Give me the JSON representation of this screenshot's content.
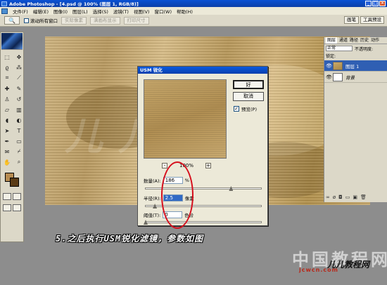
{
  "window": {
    "title": "Adobe Photoshop - [4.psd @ 100% (图层 1, RGB/8)]",
    "min_label": "_",
    "max_label": "□",
    "close_label": "×"
  },
  "menu": [
    "文件(F)",
    "编辑(E)",
    "图像(I)",
    "图层(L)",
    "选择(S)",
    "滤镜(T)",
    "视图(V)",
    "窗口(W)",
    "帮助(H)"
  ],
  "options_bar": {
    "checkbox_label": "滚动所有窗口",
    "buttons": [
      "实际像素",
      "满画布显示",
      "打印尺寸"
    ],
    "wells": [
      "画笔",
      "工具预设"
    ]
  },
  "dialog": {
    "title": "USM 锐化",
    "ok_label": "好",
    "cancel_label": "取消",
    "preview_label": "预览(P)",
    "preview_checked": "✓",
    "zoom_label": "100%",
    "zoom_out": "-",
    "zoom_in": "+",
    "amount": {
      "label": "数量(A):",
      "value": "186",
      "unit": "%"
    },
    "radius": {
      "label": "半径(R):",
      "value": "2.5",
      "unit": "像素"
    },
    "threshold": {
      "label": "阈值(T):",
      "value": "0",
      "unit": "色阶"
    },
    "amount_slider_pct": 74,
    "radius_slider_pct": 8,
    "threshold_slider_pct": 0
  },
  "layers_panel": {
    "tabs": [
      "图层",
      "通道",
      "路径",
      "历史",
      "动作"
    ],
    "blend_mode": "正常",
    "opacity_label": "不透明度:",
    "lock_label": "锁定:",
    "layers": [
      {
        "name": "图层 1",
        "eye": "👁",
        "active": true
      },
      {
        "name": "背景",
        "eye": "👁",
        "active": false
      }
    ]
  },
  "canvas_watermark": "儿儿教程",
  "caption": "5.之后执行USM锐化滤镜，参数如图",
  "branding": {
    "brand_text": "中国教程网",
    "site": "jcwcn.com",
    "logo_text": "儿儿教程网"
  },
  "colors": {
    "foreground": "#b78c52",
    "background": "#5a3b15",
    "annotation_circle": "#d60f1d",
    "title_bar": "#0a52d4"
  },
  "tools": [
    "marquee-icon",
    "move-icon",
    "lasso-icon",
    "magic-wand-icon",
    "crop-icon",
    "slice-icon",
    "healing-icon",
    "brush-icon",
    "stamp-icon",
    "history-brush-icon",
    "eraser-icon",
    "gradient-icon",
    "blur-icon",
    "dodge-icon",
    "path-select-icon",
    "type-icon",
    "pen-icon",
    "shape-icon",
    "notes-icon",
    "eyedropper-icon",
    "hand-icon",
    "zoom-icon"
  ]
}
